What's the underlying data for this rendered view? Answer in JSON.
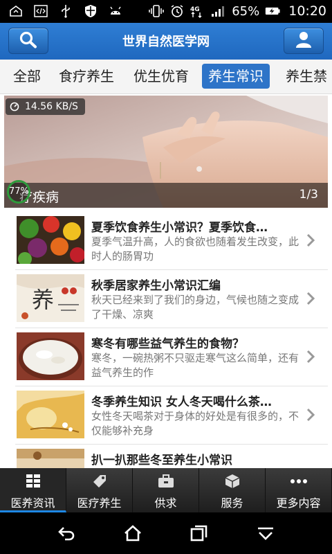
{
  "status_bar": {
    "battery_percent": "65%",
    "time": "10:20",
    "network": "4G"
  },
  "header": {
    "title": "世界自然医学网",
    "search_icon": "search-icon",
    "user_icon": "user-icon"
  },
  "tabs": [
    {
      "label": "全部",
      "active": false
    },
    {
      "label": "食疗养生",
      "active": false
    },
    {
      "label": "优生优育",
      "active": false
    },
    {
      "label": "养生常识",
      "active": true
    },
    {
      "label": "养生禁",
      "active": false
    }
  ],
  "banner": {
    "speed": "14.56 KB/S",
    "progress": "77%",
    "caption": "疗疾病",
    "counter": "1/3"
  },
  "articles": [
    {
      "title": "夏季饮食养生小常识？夏季饮食…",
      "desc": "夏季气温升高，人的食欲也随着发生改变，此时人的肠胃功"
    },
    {
      "title": "秋季居家养生小常识汇编",
      "desc": "秋天已经来到了我们的身边，气候也随之变成了干燥、凉爽"
    },
    {
      "title": "寒冬有哪些益气养生的食物？",
      "desc": "寒冬，一碗热粥不只驱走寒气这么简单，还有益气养生的作"
    },
    {
      "title": "冬季养生知识 女人冬天喝什么茶…",
      "desc": "女性冬天喝茶对于身体的好处是有很多的，不仅能够补充身"
    },
    {
      "title": "扒一扒那些冬至养生小常识",
      "desc": ""
    }
  ],
  "bottom_nav": [
    {
      "label": "医养资讯",
      "icon": "grid-icon",
      "active": true
    },
    {
      "label": "医疗养生",
      "icon": "tag-icon",
      "active": false
    },
    {
      "label": "供求",
      "icon": "briefcase-icon",
      "active": false
    },
    {
      "label": "服务",
      "icon": "cube-icon",
      "active": false
    },
    {
      "label": "更多内容",
      "icon": "more-dots-icon",
      "active": false
    }
  ],
  "colors": {
    "header_blue": "#2f7ed4",
    "tab_active": "#2e74c8",
    "nav_active_underline": "#1e88e5"
  }
}
